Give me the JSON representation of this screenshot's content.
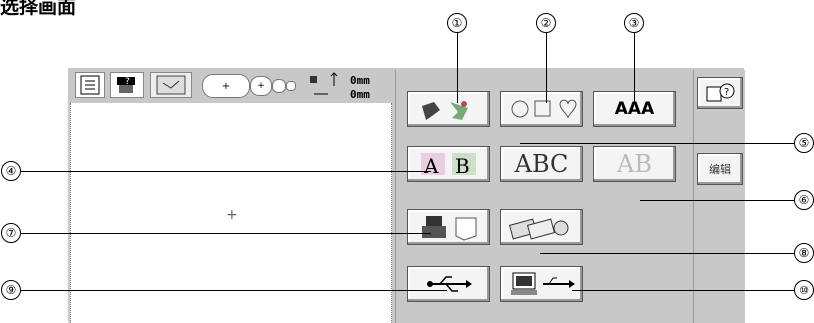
{
  "page_title": "选择画面",
  "callouts": [
    "①",
    "②",
    "③",
    "④",
    "⑤",
    "⑥",
    "⑦",
    "⑧",
    "⑨",
    "⑩"
  ],
  "toolbar": {
    "size_w": "0mm",
    "size_h": "0mm",
    "hoop_plus": "+",
    "hoop_plus2": "+"
  },
  "buttons": {
    "font_aaa": "AAA",
    "alpha_ab": "AB",
    "abc": "ABC",
    "ab_outline": "AB",
    "edit": "编辑",
    "arrow": "→"
  },
  "preview_cross": "+"
}
